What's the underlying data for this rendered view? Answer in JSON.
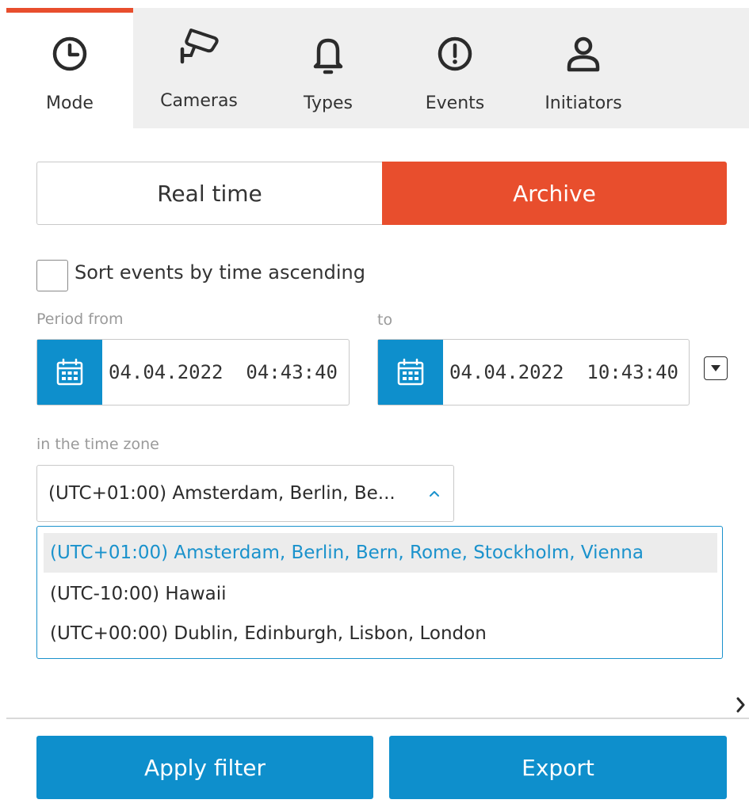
{
  "tabs": [
    {
      "label": "Mode",
      "icon": "clock-icon",
      "active": true
    },
    {
      "label": "Cameras",
      "icon": "camera-icon",
      "active": false
    },
    {
      "label": "Types",
      "icon": "bell-icon",
      "active": false
    },
    {
      "label": "Events",
      "icon": "alert-circle-icon",
      "active": false
    },
    {
      "label": "Initiators",
      "icon": "user-icon",
      "active": false
    }
  ],
  "mode": {
    "realtime_label": "Real time",
    "archive_label": "Archive",
    "selected": "Archive"
  },
  "sort": {
    "label": "Sort events by time ascending",
    "checked": false
  },
  "period": {
    "from_label": "Period from",
    "to_label": "to",
    "from_value": "04.04.2022  04:43:40",
    "to_value": "04.04.2022  10:43:40"
  },
  "timezone": {
    "label": "in the time zone",
    "selected_display": "(UTC+01:00) Amsterdam, Berlin, Be...",
    "options": [
      "(UTC+01:00) Amsterdam, Berlin, Bern, Rome, Stockholm, Vienna",
      "(UTC-10:00) Hawaii",
      "(UTC+00:00) Dublin, Edinburgh, Lisbon, London"
    ],
    "selected_index": 0
  },
  "actions": {
    "apply_label": "Apply filter",
    "export_label": "Export"
  },
  "colors": {
    "accent": "#e84e2d",
    "primary": "#0e8fcc",
    "selected_text": "#1a92cc",
    "tabbar_bg": "#efefef"
  }
}
